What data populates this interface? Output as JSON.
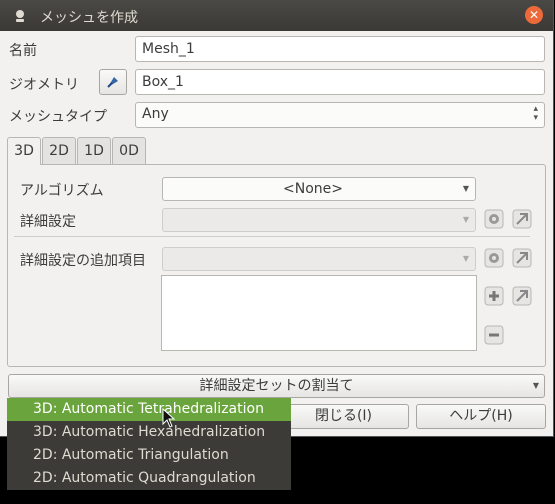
{
  "window": {
    "title": "メッシュを作成",
    "close_glyph": "✕"
  },
  "form": {
    "name_label": "名前",
    "name_value": "Mesh_1",
    "geometry_label": "ジオメトリ",
    "geometry_value": "Box_1",
    "mesh_type_label": "メッシュタイプ",
    "mesh_type_value": "Any"
  },
  "tabs": [
    {
      "label": "3D",
      "active": true
    },
    {
      "label": "2D",
      "active": false
    },
    {
      "label": "1D",
      "active": false
    },
    {
      "label": "0D",
      "active": false
    }
  ],
  "panel": {
    "algorithm_label": "アルゴリズム",
    "algorithm_value": "<None>",
    "hypothesis_label": "詳細設定",
    "additional_label": "詳細設定の追加項目"
  },
  "buttons": {
    "assign_set": "詳細設定セットの割当て",
    "close": "閉じる(I)",
    "help": "ヘルプ(H)"
  },
  "popup_items": [
    "3D: Automatic Tetrahedralization",
    "3D: Automatic Hexahedralization",
    "2D: Automatic Triangulation",
    "2D: Automatic Quadrangulation"
  ],
  "colors": {
    "accent": "#6aa43c",
    "titlebar": "#3c3b37",
    "close_button": "#ec6a3a"
  }
}
